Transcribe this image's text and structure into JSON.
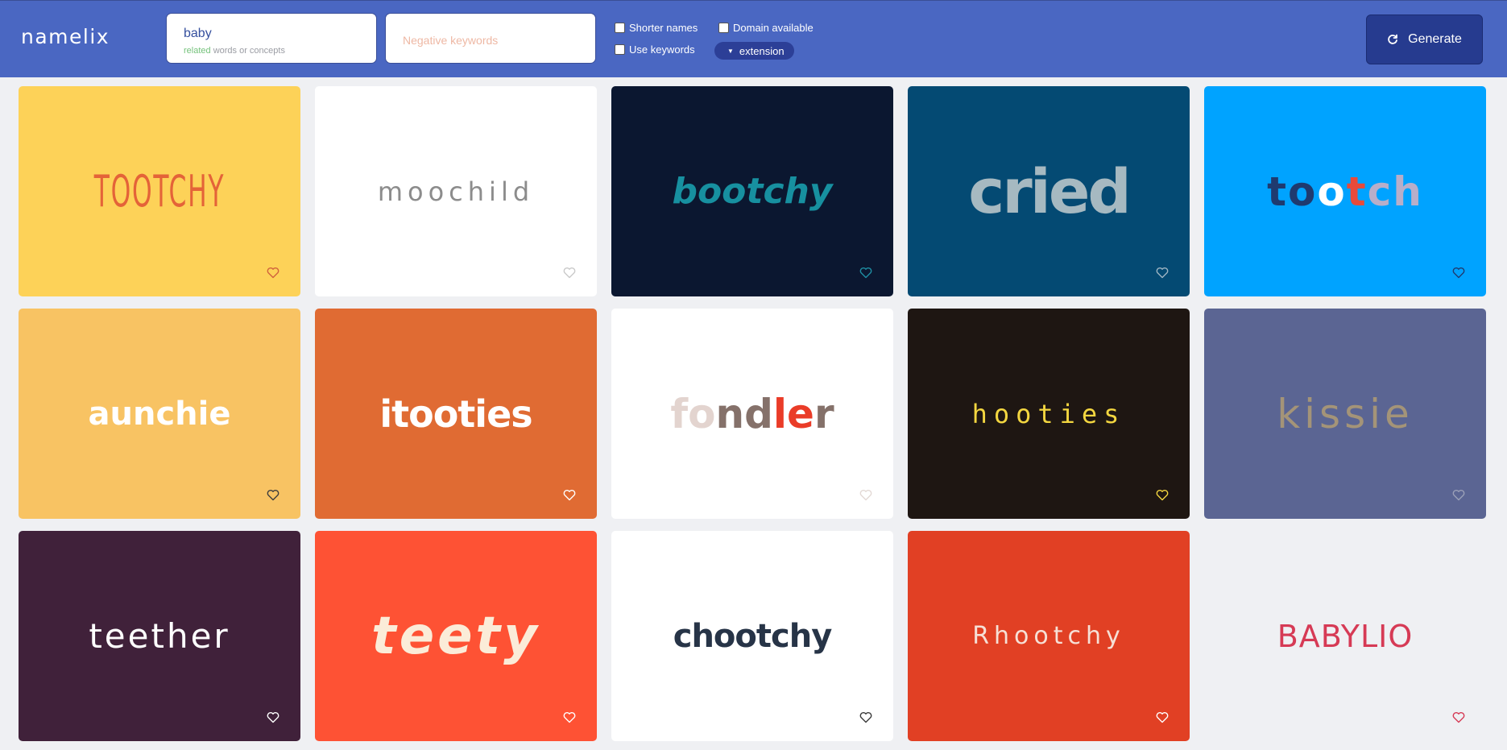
{
  "app": {
    "logo": "namelix"
  },
  "search": {
    "keywords_value": "baby",
    "keywords_hint_green": "related",
    "keywords_hint_rest": " words or concepts",
    "negative_placeholder": "Negative keywords"
  },
  "options": {
    "shorter_names": "Shorter names",
    "use_keywords": "Use keywords",
    "domain_available": "Domain available",
    "extension": "extension"
  },
  "generate_label": "Generate",
  "colors": {
    "header": "#4a67c2",
    "generate_button": "#263b8f",
    "page_background": "#eff0f3"
  },
  "cards": [
    {
      "name": "TOOTCHY"
    },
    {
      "name": "moochild"
    },
    {
      "name": "bootchy"
    },
    {
      "name": "cried"
    },
    {
      "name": "tootch",
      "letters": [
        "to",
        "o",
        "t",
        "ch"
      ]
    },
    {
      "name": "aunchie"
    },
    {
      "name": "itooties"
    },
    {
      "name": "fondler",
      "letters": [
        "fo",
        "nd",
        "le",
        "r"
      ]
    },
    {
      "name": "hooties"
    },
    {
      "name": "kissie"
    },
    {
      "name": "teether"
    },
    {
      "name": "teety"
    },
    {
      "name": "chootchy"
    },
    {
      "name": "Rhootchy"
    },
    {
      "name": "BABYLIO"
    }
  ],
  "icons": {
    "favorite": "heart-outline-icon",
    "generate": "refresh-icon",
    "extension_toggle": "triangle-down-icon"
  }
}
